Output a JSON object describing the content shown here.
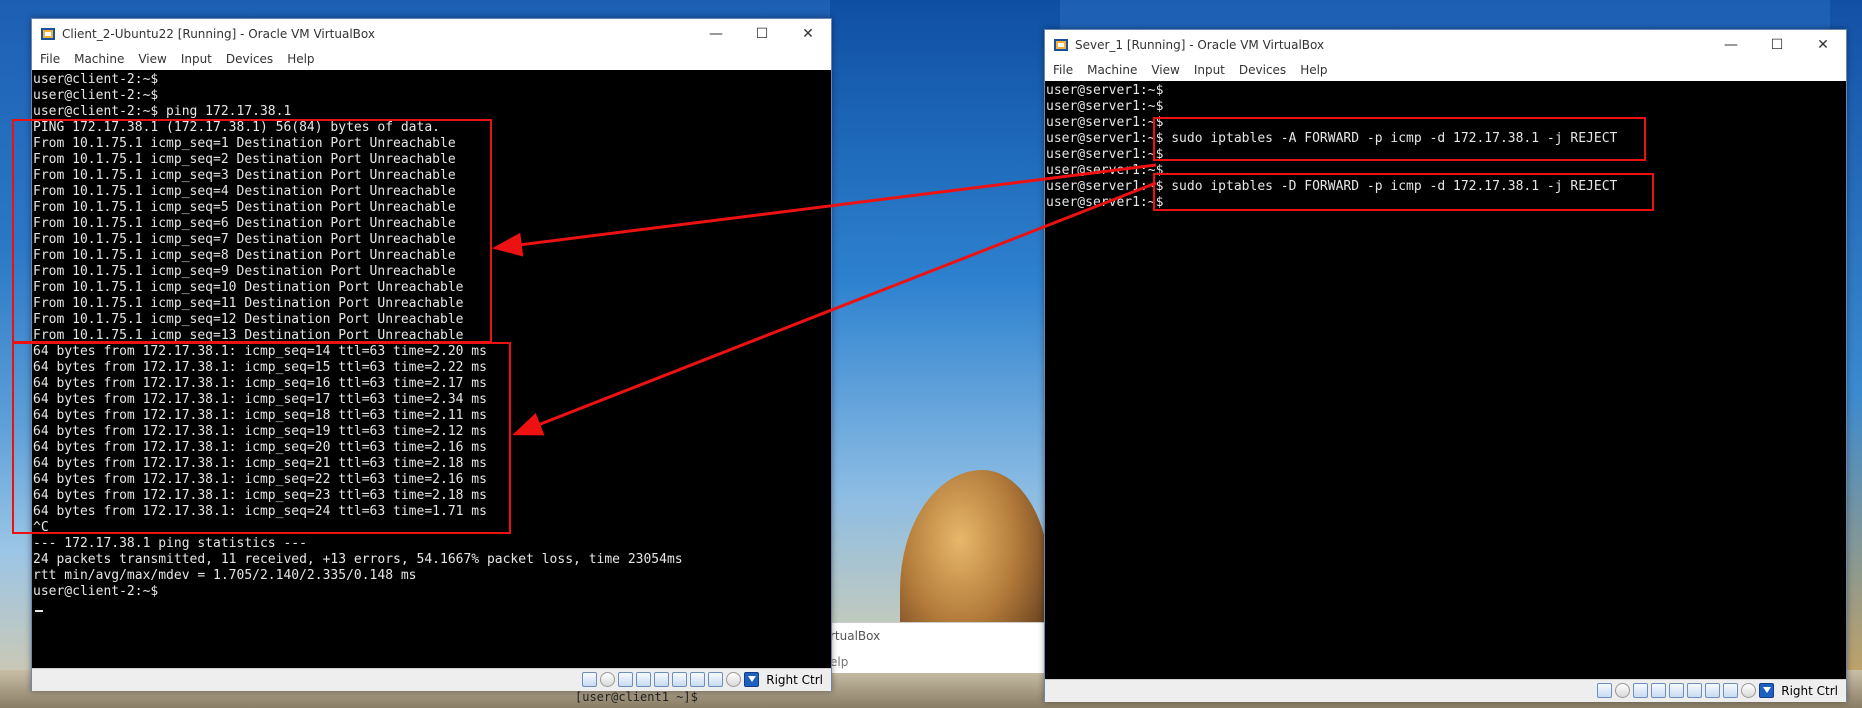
{
  "desktop": {
    "bg_window_title": "rtualBox",
    "bg_window_help": "elp",
    "bg_console_prompt": "[user@client1 ~]$"
  },
  "client_window": {
    "title": "Client_2-Ubuntu22 [Running] - Oracle VM VirtualBox",
    "menu": [
      "File",
      "Machine",
      "View",
      "Input",
      "Devices",
      "Help"
    ],
    "terminal_lines": [
      "user@client-2:~$",
      "user@client-2:~$",
      "user@client-2:~$ ping 172.17.38.1",
      "PING 172.17.38.1 (172.17.38.1) 56(84) bytes of data.",
      "From 10.1.75.1 icmp_seq=1 Destination Port Unreachable",
      "From 10.1.75.1 icmp_seq=2 Destination Port Unreachable",
      "From 10.1.75.1 icmp_seq=3 Destination Port Unreachable",
      "From 10.1.75.1 icmp_seq=4 Destination Port Unreachable",
      "From 10.1.75.1 icmp_seq=5 Destination Port Unreachable",
      "From 10.1.75.1 icmp_seq=6 Destination Port Unreachable",
      "From 10.1.75.1 icmp_seq=7 Destination Port Unreachable",
      "From 10.1.75.1 icmp_seq=8 Destination Port Unreachable",
      "From 10.1.75.1 icmp_seq=9 Destination Port Unreachable",
      "From 10.1.75.1 icmp_seq=10 Destination Port Unreachable",
      "From 10.1.75.1 icmp_seq=11 Destination Port Unreachable",
      "From 10.1.75.1 icmp_seq=12 Destination Port Unreachable",
      "From 10.1.75.1 icmp_seq=13 Destination Port Unreachable",
      "64 bytes from 172.17.38.1: icmp_seq=14 ttl=63 time=2.20 ms",
      "64 bytes from 172.17.38.1: icmp_seq=15 ttl=63 time=2.22 ms",
      "64 bytes from 172.17.38.1: icmp_seq=16 ttl=63 time=2.17 ms",
      "64 bytes from 172.17.38.1: icmp_seq=17 ttl=63 time=2.34 ms",
      "64 bytes from 172.17.38.1: icmp_seq=18 ttl=63 time=2.11 ms",
      "64 bytes from 172.17.38.1: icmp_seq=19 ttl=63 time=2.12 ms",
      "64 bytes from 172.17.38.1: icmp_seq=20 ttl=63 time=2.16 ms",
      "64 bytes from 172.17.38.1: icmp_seq=21 ttl=63 time=2.18 ms",
      "64 bytes from 172.17.38.1: icmp_seq=22 ttl=63 time=2.16 ms",
      "64 bytes from 172.17.38.1: icmp_seq=23 ttl=63 time=2.18 ms",
      "64 bytes from 172.17.38.1: icmp_seq=24 ttl=63 time=1.71 ms",
      "^C",
      "--- 172.17.38.1 ping statistics ---",
      "24 packets transmitted, 11 received, +13 errors, 54.1667% packet loss, time 23054ms",
      "rtt min/avg/max/mdev = 1.705/2.140/2.335/0.148 ms",
      "user@client-2:~$"
    ],
    "host_key": "Right Ctrl"
  },
  "server_window": {
    "title": "Sever_1 [Running] - Oracle VM VirtualBox",
    "menu": [
      "File",
      "Machine",
      "View",
      "Input",
      "Devices",
      "Help"
    ],
    "terminal_lines": [
      "user@server1:~$",
      "user@server1:~$",
      "user@server1:~$",
      "user@server1:~$ sudo iptables -A FORWARD -p icmp -d 172.17.38.1 -j REJECT",
      "user@server1:~$",
      "user@server1:~$",
      "user@server1:~$ sudo iptables -D FORWARD -p icmp -d 172.17.38.1 -j REJECT",
      "user@server1:~$"
    ],
    "host_key": "Right Ctrl"
  },
  "colors": {
    "annotation_red": "#e11111",
    "terminal_bg": "#000000",
    "terminal_fg": "#e6e6e6"
  },
  "icons": {
    "window_controls": [
      "minimize-icon",
      "maximize-icon",
      "close-icon"
    ],
    "status_bar": [
      "hard-disk-icon",
      "optical-drive-icon",
      "audio-icon",
      "network-icon",
      "usb-icon",
      "shared-folders-icon",
      "display-icon",
      "video-capture-icon",
      "mouse-integration-icon",
      "keyboard-capture-icon"
    ]
  }
}
